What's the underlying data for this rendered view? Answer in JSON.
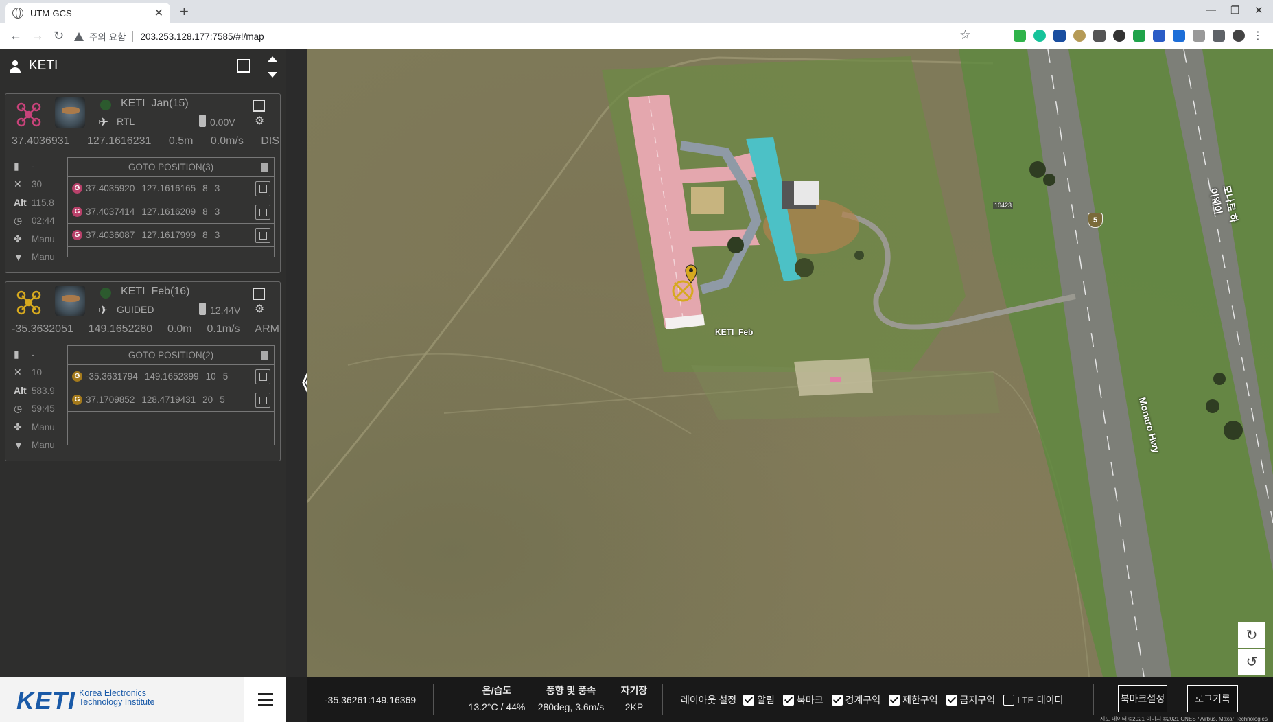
{
  "browser": {
    "tab_title": "UTM-GCS",
    "security_label": "주의 요함",
    "url": "203.253.128.177:7585/#!/map"
  },
  "panel": {
    "title": "KETI"
  },
  "drones": [
    {
      "name": "KETI_Jan(15)",
      "mode": "RTL",
      "voltage": "0.00V",
      "lat": "37.4036931",
      "lon": "127.1616231",
      "alt_rel": "0.5m",
      "speed": "0.0m/s",
      "state": "DIS",
      "signal": "-",
      "sats": "30",
      "alt_label": "Alt",
      "alt": "115.8",
      "time": "02:44",
      "drone_mode": "Manu",
      "gimbal_mode": "Manu",
      "goto_title": "GOTO POSITION(3)",
      "accent": "#c8437a",
      "goto": [
        {
          "lat": "37.4035920",
          "lon": "127.1616165",
          "a": "8",
          "b": "3"
        },
        {
          "lat": "37.4037414",
          "lon": "127.1616209",
          "a": "8",
          "b": "3"
        },
        {
          "lat": "37.4036087",
          "lon": "127.1617999",
          "a": "8",
          "b": "3"
        }
      ]
    },
    {
      "name": "KETI_Feb(16)",
      "mode": "GUIDED",
      "voltage": "12.44V",
      "lat": "-35.3632051",
      "lon": "149.1652280",
      "alt_rel": "0.0m",
      "speed": "0.1m/s",
      "state": "ARM",
      "signal": "-",
      "sats": "10",
      "alt_label": "Alt",
      "alt": "583.9",
      "time": "59:45",
      "drone_mode": "Manu",
      "gimbal_mode": "Manu",
      "goto_title": "GOTO POSITION(2)",
      "accent": "#d6a91f",
      "goto": [
        {
          "lat": "-35.3631794",
          "lon": "149.1652399",
          "a": "10",
          "b": "5"
        },
        {
          "lat": "37.1709852",
          "lon": "128.4719431",
          "a": "20",
          "b": "5"
        }
      ]
    }
  ],
  "map": {
    "drone_label": "KETI_Feb",
    "highway_label": "Monaro Hwy",
    "highway_label_ko": "모나로 하이웨이",
    "road_shield": "5",
    "parcel_tag": "10423",
    "rotate_cw_icon": "rotate-cw-icon",
    "rotate_ccw_icon": "rotate-ccw-icon"
  },
  "statusbar": {
    "coord": "-35.36261:149.16369",
    "temp_hum_label": "온/습도",
    "temp_hum_value": "13.2°C / 44%",
    "wind_label": "풍향 및 풍속",
    "wind_value": "280deg, 3.6m/s",
    "mag_label": "자기장",
    "mag_value": "2KP",
    "layout_label": "레이아웃 설정",
    "layers": [
      {
        "label": "알림",
        "checked": true
      },
      {
        "label": "북마크",
        "checked": true
      },
      {
        "label": "경계구역",
        "checked": true
      },
      {
        "label": "제한구역",
        "checked": true
      },
      {
        "label": "금지구역",
        "checked": true
      },
      {
        "label": "LTE 데이터",
        "checked": false
      }
    ],
    "bookmark_btn": "북마크설정",
    "log_btn": "로그기록",
    "copyright": "지도 데이터 ©2021 이미지 ©2021 CNES / Airbus, Maxar Technologies"
  },
  "logo": {
    "main": "KETI",
    "line1": "Korea Electronics",
    "line2": "Technology Institute"
  }
}
